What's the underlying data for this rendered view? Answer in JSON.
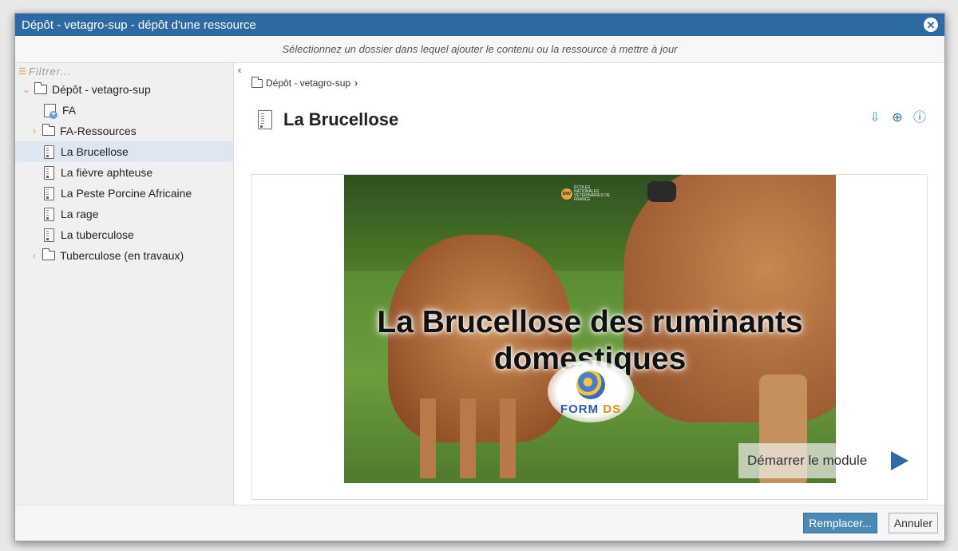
{
  "window": {
    "title": "Dépôt - vetagro-sup - dépôt d'une ressource",
    "close_icon": "close-icon"
  },
  "instruction": "Sélectionnez un dossier dans lequel ajouter le contenu ou la ressource à mettre à jour",
  "sidebar": {
    "filter_placeholder": "Filtrer...",
    "collapse_icon": "double-chevron-left-icon",
    "tree": [
      {
        "label": "Dépôt - vetagro-sup",
        "type": "folder",
        "expanded": true
      },
      {
        "label": "FA",
        "type": "package"
      },
      {
        "label": "FA-Ressources",
        "type": "folder",
        "expanded": false
      },
      {
        "label": "La Brucellose",
        "type": "document",
        "selected": true
      },
      {
        "label": "La fièvre aphteuse",
        "type": "document"
      },
      {
        "label": "La Peste Porcine Africaine",
        "type": "document"
      },
      {
        "label": "La rage",
        "type": "document"
      },
      {
        "label": "La tuberculose",
        "type": "document"
      },
      {
        "label": "Tuberculose (en travaux)",
        "type": "folder",
        "expanded": false
      }
    ]
  },
  "main": {
    "breadcrumb": "Dépôt - vetagro-sup",
    "resource_title": "La Brucellose",
    "actions": [
      "download-icon",
      "globe-icon",
      "info-icon"
    ],
    "preview": {
      "title_line1": "La Brucellose des ruminants",
      "title_line2": "domestiques",
      "ens_badge": "ENV",
      "ens_logo_text": "ÉCOLES NATIONALES VÉTÉRINAIRES DE FRANCE",
      "brand_prefix": "FORM",
      "brand_suffix": "DS",
      "start_label": "Démarrer le module"
    }
  },
  "footer": {
    "replace_label": "Remplacer...",
    "cancel_label": "Annuler"
  },
  "colors": {
    "titlebar": "#2d6aa3",
    "accent": "#2d6aa3",
    "selected_row": "#dde6f1",
    "primary_button": "#4a8ab5"
  }
}
